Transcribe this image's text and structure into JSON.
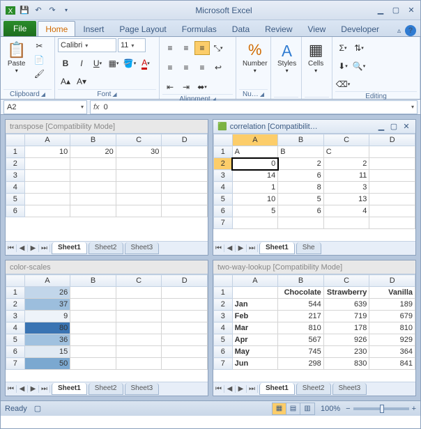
{
  "app": {
    "title": "Microsoft Excel"
  },
  "tabs": {
    "file": "File",
    "home": "Home",
    "insert": "Insert",
    "page_layout": "Page Layout",
    "formulas": "Formulas",
    "data": "Data",
    "review": "Review",
    "view": "View",
    "developer": "Developer"
  },
  "ribbon": {
    "clipboard": {
      "paste": "Paste",
      "label": "Clipboard"
    },
    "font": {
      "name": "Calibri",
      "size": "11",
      "label": "Font"
    },
    "alignment": {
      "label": "Alignment"
    },
    "number": {
      "btn": "Number",
      "label": "Nu…"
    },
    "styles": {
      "btn": "Styles",
      "label": ""
    },
    "cells": {
      "btn": "Cells",
      "label": ""
    },
    "editing": {
      "label": "Editing"
    }
  },
  "formula_bar": {
    "name_box": "A2",
    "fx": "fx",
    "value": "0"
  },
  "workbooks": {
    "transpose": {
      "title": "transpose  [Compatibility Mode]",
      "cols": [
        "A",
        "B",
        "C",
        "D"
      ],
      "rows": [
        {
          "n": 1,
          "cells": [
            "10",
            "20",
            "30",
            ""
          ]
        },
        {
          "n": 2,
          "cells": [
            "",
            "",
            "",
            ""
          ]
        },
        {
          "n": 3,
          "cells": [
            "",
            "",
            "",
            ""
          ]
        },
        {
          "n": 4,
          "cells": [
            "",
            "",
            "",
            ""
          ]
        },
        {
          "n": 5,
          "cells": [
            "",
            "",
            "",
            ""
          ]
        },
        {
          "n": 6,
          "cells": [
            "",
            "",
            "",
            ""
          ]
        }
      ],
      "sheets": [
        "Sheet1",
        "Sheet2",
        "Sheet3"
      ]
    },
    "correlation": {
      "title": "correlation  [Compatibilit…",
      "cols": [
        "A",
        "B",
        "C",
        "D"
      ],
      "rows": [
        {
          "n": 1,
          "cells": [
            "A",
            "B",
            "C",
            ""
          ],
          "lt": true
        },
        {
          "n": 2,
          "cells": [
            "0",
            "2",
            "2",
            ""
          ],
          "sel": 0
        },
        {
          "n": 3,
          "cells": [
            "14",
            "6",
            "11",
            ""
          ]
        },
        {
          "n": 4,
          "cells": [
            "1",
            "8",
            "3",
            ""
          ]
        },
        {
          "n": 5,
          "cells": [
            "10",
            "5",
            "13",
            ""
          ]
        },
        {
          "n": 6,
          "cells": [
            "5",
            "6",
            "4",
            ""
          ]
        },
        {
          "n": 7,
          "cells": [
            "",
            "",
            "",
            ""
          ]
        }
      ],
      "sheets": [
        "Sheet1",
        "She"
      ]
    },
    "colorscales": {
      "title": "color-scales",
      "cols": [
        "A",
        "B",
        "C",
        "D"
      ],
      "rows": [
        {
          "n": 1,
          "cells": [
            "26",
            "",
            "",
            ""
          ],
          "shade": "#c2d6ea"
        },
        {
          "n": 2,
          "cells": [
            "37",
            "",
            "",
            ""
          ],
          "shade": "#9cbedd"
        },
        {
          "n": 3,
          "cells": [
            "9",
            "",
            "",
            ""
          ],
          "shade": "#eef3f9"
        },
        {
          "n": 4,
          "cells": [
            "80",
            "",
            "",
            ""
          ],
          "shade": "#3a74b3"
        },
        {
          "n": 5,
          "cells": [
            "36",
            "",
            "",
            ""
          ],
          "shade": "#a0c1df"
        },
        {
          "n": 6,
          "cells": [
            "15",
            "",
            "",
            ""
          ],
          "shade": "#e1eaf3"
        },
        {
          "n": 7,
          "cells": [
            "50",
            "",
            "",
            ""
          ],
          "shade": "#7ba8d0"
        }
      ],
      "sheets": [
        "Sheet1",
        "Sheet2",
        "Sheet3"
      ]
    },
    "twoway": {
      "title": "two-way-lookup  [Compatibility Mode]",
      "cols": [
        "A",
        "B",
        "C",
        "D"
      ],
      "rows": [
        {
          "n": 1,
          "cells": [
            "",
            "Chocolate",
            "Strawberry",
            "Vanilla"
          ],
          "bold": true
        },
        {
          "n": 2,
          "cells": [
            "Jan",
            "544",
            "639",
            "189"
          ],
          "boldfirst": true
        },
        {
          "n": 3,
          "cells": [
            "Feb",
            "217",
            "719",
            "679"
          ],
          "boldfirst": true
        },
        {
          "n": 4,
          "cells": [
            "Mar",
            "810",
            "178",
            "810"
          ],
          "boldfirst": true
        },
        {
          "n": 5,
          "cells": [
            "Apr",
            "567",
            "926",
            "929"
          ],
          "boldfirst": true
        },
        {
          "n": 6,
          "cells": [
            "May",
            "745",
            "230",
            "364"
          ],
          "boldfirst": true
        },
        {
          "n": 7,
          "cells": [
            "Jun",
            "298",
            "830",
            "841"
          ],
          "boldfirst": true
        }
      ],
      "sheets": [
        "Sheet1",
        "Sheet2",
        "Sheet3"
      ]
    }
  },
  "status": {
    "ready": "Ready",
    "zoom": "100%"
  }
}
